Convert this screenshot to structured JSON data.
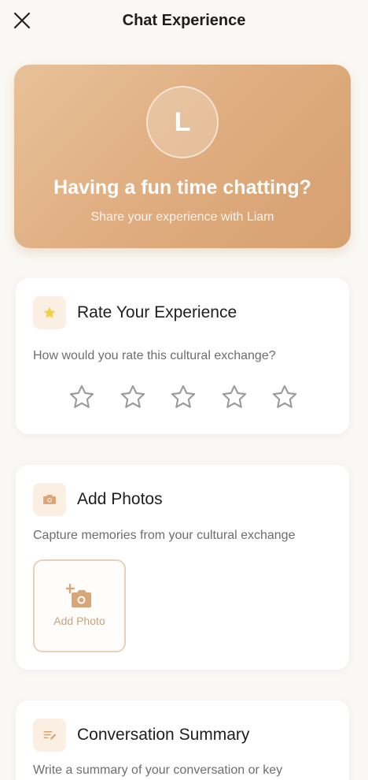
{
  "header": {
    "title": "Chat Experience",
    "close_icon": "close-icon"
  },
  "hero": {
    "avatar_initial": "L",
    "title": "Having a fun time chatting?",
    "subtitle": "Share your experience with Liam"
  },
  "rating": {
    "icon": "star-icon",
    "title": "Rate Your Experience",
    "question": "How would you rate this cultural exchange?",
    "max_stars": 5,
    "selected_stars": 0
  },
  "photos": {
    "icon": "camera-icon",
    "title": "Add Photos",
    "description": "Capture memories from your cultural exchange",
    "add_label": "Add Photo"
  },
  "summary": {
    "icon": "notes-icon",
    "title": "Conversation Summary",
    "description": "Write a summary of your conversation or key"
  },
  "colors": {
    "accent": "#d9a677",
    "hero_gradient_start": "#e8c199",
    "hero_gradient_end": "#d7a06f",
    "icon_background": "#fbeee2",
    "star_filled": "#f5cf3c"
  }
}
